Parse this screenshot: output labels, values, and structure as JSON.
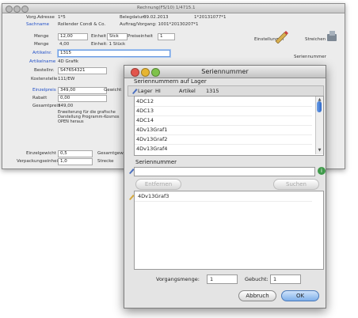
{
  "back_window": {
    "title": "Rechnung(FS/10) 1/4715.1",
    "fields_row1": {
      "label": "Vorg.Adresse",
      "value": "1*5",
      "date_label": "Belegdatum",
      "date_value": "09.02.2013",
      "number": "1*20131077*1"
    },
    "fields_row2": {
      "label": "Sachname",
      "value": "Rollender Condi & Co.",
      "ref": "Auftrag/Vorgang: 1001*20130207*1"
    },
    "menge": {
      "label": "Menge",
      "value": "12,00",
      "unit_label": "Einheit",
      "unit_value": "Stck",
      "price_label": "Preiseinheit",
      "price_value": "1"
    },
    "menge2": {
      "label": "Menge",
      "value": "4,00",
      "note": "Einheit: 1 Stück"
    },
    "artikel": {
      "label": "Artikelnr.",
      "value": "1315"
    },
    "artikelname": {
      "label": "Artikelname",
      "value": "4D Grafik"
    },
    "bestellnr": {
      "label": "Bestellnr.",
      "value": "S47654321"
    },
    "kostenstelle": {
      "label": "Kostenstelle",
      "value": "111/EW"
    },
    "einzelpreis": {
      "label": "Einzelpreis",
      "value": "349,00",
      "side_label": "Gewicht"
    },
    "rabatt": {
      "label": "Rabatt",
      "value": "0,00"
    },
    "gesamt": {
      "label": "Gesamtpreis",
      "value": "349,00"
    },
    "description": "Erweiterung für die grafische Darstellung Programm-Kosmos OPEN heraus",
    "bottom": {
      "label1": "Einzelgewicht",
      "value1": "0,5",
      "label2": "Verpackungseinheit",
      "value2": "1,0",
      "side1": "Gesamtgew.",
      "side2": "Strecke"
    },
    "tools": {
      "label1": "Einstellungen",
      "label2": "Streichen",
      "serial_label": "Seriennummer"
    }
  },
  "dialog": {
    "title": "Seriennummer",
    "section1_title": "Seriennummern auf Lager",
    "lager_label": "Lager",
    "lager_value": "HI",
    "artikel_label": "Artikel",
    "artikel_value": "1315",
    "lager_items": [
      "4DC12",
      "4DC13",
      "4DC14",
      "4Dv13Graf1",
      "4Dv13Graf2",
      "4Dv13Graf4"
    ],
    "section2_title": "Seriennummer",
    "entfernen": "Entfernen",
    "suchen": "Suchen",
    "assigned_items": [
      "4Dv13Graf3"
    ],
    "vorgangsmenge_label": "Vorgangsmenge:",
    "vorgangsmenge_value": "1",
    "gebucht_label": "Gebucht:",
    "gebucht_value": "1",
    "abbruch": "Abbruch",
    "ok": "OK"
  },
  "colors": {
    "accent_blue": "#2250c8",
    "ok_blue": "#7fb0ea"
  }
}
